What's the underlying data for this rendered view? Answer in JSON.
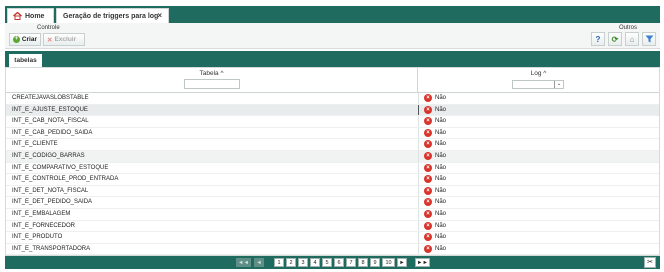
{
  "tabs": {
    "home": "Home",
    "active": "Geração de triggers para log",
    "close": "×"
  },
  "toolbar": {
    "group_controle": "Controle",
    "criar": "Criar",
    "excluir": "Excluir",
    "group_outros": "Outros"
  },
  "subtab": "tabelas",
  "grid": {
    "col_tabela": "Tabela ^",
    "col_log": "Log ^",
    "log_filter_arrow": "⌄",
    "rows": [
      {
        "name": "CREATEJAVASLOBSTABLE",
        "log": "Não"
      },
      {
        "name": "INT_E_AJUSTE_ESTOQUE",
        "log": "Não"
      },
      {
        "name": "INT_E_CAB_NOTA_FISCAL",
        "log": "Não"
      },
      {
        "name": "INT_E_CAB_PEDIDO_SAIDA",
        "log": "Não"
      },
      {
        "name": "INT_E_CLIENTE",
        "log": "Não"
      },
      {
        "name": "INT_E_CODIGO_BARRAS",
        "log": "Não"
      },
      {
        "name": "INT_E_COMPARATIVO_ESTOQUE",
        "log": "Não"
      },
      {
        "name": "INT_E_CONTROLE_PROD_ENTRADA",
        "log": "Não"
      },
      {
        "name": "INT_E_DET_NOTA_FISCAL",
        "log": "Não"
      },
      {
        "name": "INT_E_DET_PEDIDO_SAIDA",
        "log": "Não"
      },
      {
        "name": "INT_E_EMBALAGEM",
        "log": "Não"
      },
      {
        "name": "INT_E_FORNECEDOR",
        "log": "Não"
      },
      {
        "name": "INT_E_PRODUTO",
        "log": "Não"
      },
      {
        "name": "INT_E_TRANSPORTADORA",
        "log": "Não"
      }
    ]
  },
  "pager": {
    "first": "◄◄",
    "prev": "◄",
    "pages": [
      "1",
      "2",
      "3",
      "4",
      "5",
      "6",
      "7",
      "8",
      "9",
      "10"
    ],
    "next": "►",
    "last": "►►"
  },
  "colors": {
    "brand": "#1f6b60",
    "error": "#d9342b"
  }
}
